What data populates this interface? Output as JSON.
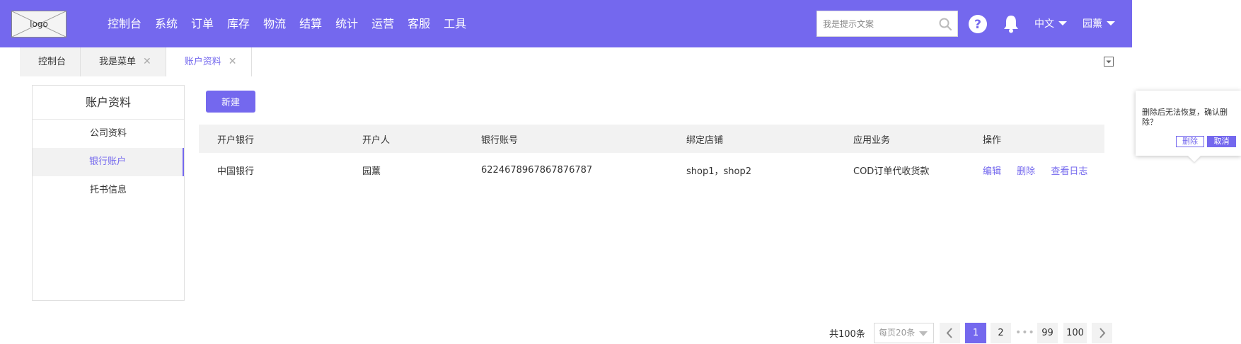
{
  "header": {
    "logo_text": "logo",
    "nav": [
      "控制台",
      "系统",
      "订单",
      "库存",
      "物流",
      "结算",
      "统计",
      "运营",
      "客服",
      "工具"
    ],
    "search_placeholder": "我是提示文案",
    "language": "中文",
    "user": "园薰",
    "brand_color": "#7468ee"
  },
  "tabs": [
    {
      "label": "控制台",
      "closable": false,
      "active": false
    },
    {
      "label": "我是菜单",
      "closable": true,
      "active": false
    },
    {
      "label": "账户资料",
      "closable": true,
      "active": true
    }
  ],
  "sidebar": {
    "title": "账户资料",
    "items": [
      "公司资料",
      "银行账户",
      "托书信息"
    ],
    "active_index": 1
  },
  "main": {
    "new_button": "新建",
    "columns": [
      "开户银行",
      "开户人",
      "银行账号",
      "绑定店铺",
      "应用业务",
      "操作"
    ],
    "rows": [
      {
        "bank": "中国银行",
        "holder": "园薰",
        "account": "6224678967867876787",
        "shops": "shop1，shop2",
        "business": "COD订单代收货款",
        "actions": [
          "编辑",
          "删除",
          "查看日志"
        ]
      }
    ]
  },
  "pagination": {
    "total": "共100条",
    "page_size": "每页20条",
    "pages": [
      "1",
      "2",
      "99",
      "100"
    ],
    "current": "1",
    "ellipsis": "•••"
  },
  "popconfirm": {
    "message": "删除后无法恢复，确认删除？",
    "confirm_label": "删除",
    "cancel_label": "取消"
  }
}
